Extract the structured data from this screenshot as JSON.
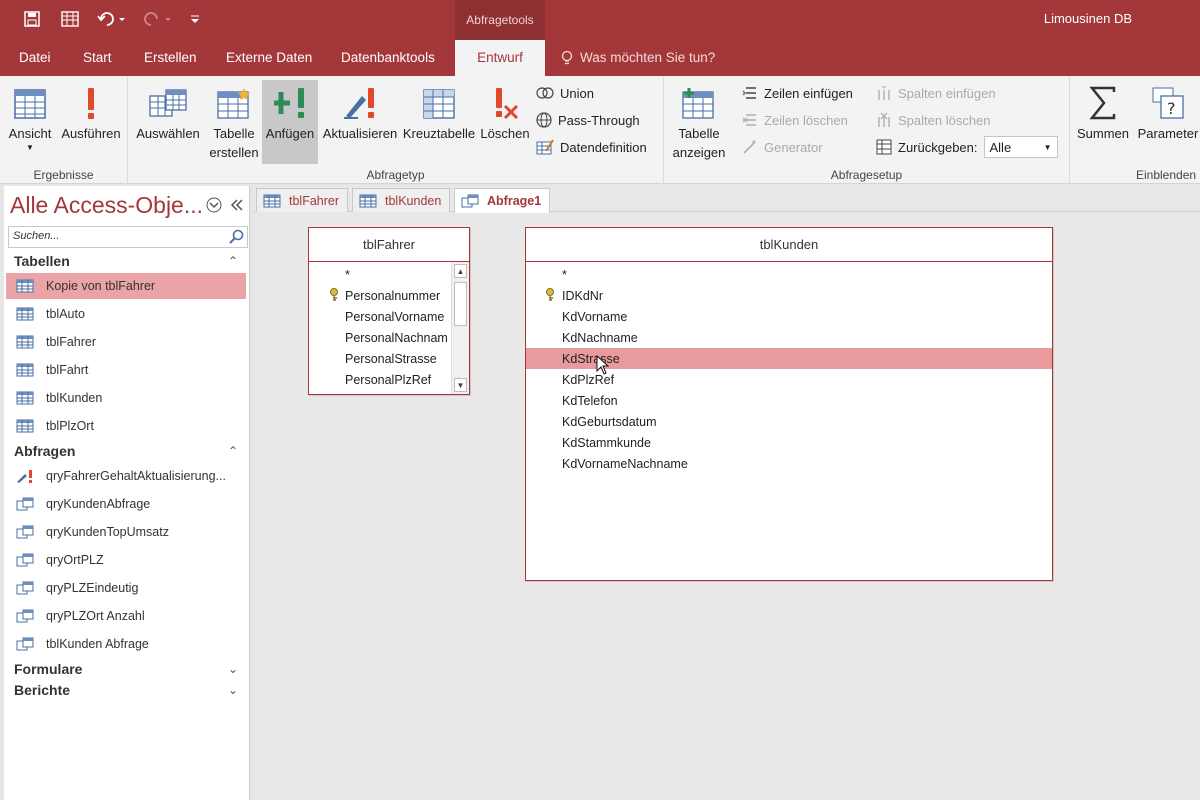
{
  "window": {
    "context_tab": "Abfragetools",
    "title": "Limousinen DB"
  },
  "ribbon_tabs": [
    "Datei",
    "Start",
    "Erstellen",
    "Externe Daten",
    "Datenbanktools",
    "Entwurf"
  ],
  "tell_me": "Was möchten Sie tun?",
  "ribbon": {
    "ergebnisse": {
      "label": "Ergebnisse",
      "ansicht": "Ansicht",
      "ausfuehren": "Ausführen"
    },
    "abfragetyp": {
      "label": "Abfragetyp",
      "auswaehlen": "Auswählen",
      "tabelle_erstellen_1": "Tabelle",
      "tabelle_erstellen_2": "erstellen",
      "anfuegen": "Anfügen",
      "aktualisieren": "Aktualisieren",
      "kreuztabelle": "Kreuztabelle",
      "loeschen": "Löschen",
      "union": "Union",
      "pass_through": "Pass-Through",
      "datendefinition": "Datendefinition"
    },
    "abfragesetup": {
      "label": "Abfragesetup",
      "tabelle_anzeigen_1": "Tabelle",
      "tabelle_anzeigen_2": "anzeigen",
      "zeilen_einfuegen": "Zeilen einfügen",
      "zeilen_loeschen": "Zeilen löschen",
      "generator": "Generator",
      "spalten_einfuegen": "Spalten einfügen",
      "spalten_loeschen": "Spalten löschen",
      "zurueckgeben": "Zurückgeben:",
      "zurueckgeben_value": "Alle"
    },
    "einblenden": {
      "label": "Einblenden",
      "summen": "Summen",
      "parameter": "Parameter"
    }
  },
  "nav": {
    "title": "Alle Access-Obje...",
    "search_placeholder": "Suchen...",
    "sections": {
      "tabellen": "Tabellen",
      "abfragen": "Abfragen",
      "formulare": "Formulare",
      "berichte": "Berichte"
    },
    "tables": [
      "Kopie von tblFahrer",
      "tblAuto",
      "tblFahrer",
      "tblFahrt",
      "tblKunden",
      "tblPlzOrt"
    ],
    "queries": [
      "qryFahrerGehaltAktualisierung...",
      "qryKundenAbfrage",
      "qryKundenTopUmsatz",
      "qryOrtPLZ",
      "qryPLZEindeutig",
      "qryPLZOrt Anzahl",
      "tblKunden Abfrage"
    ]
  },
  "doc_tabs": [
    "tblFahrer",
    "tblKunden",
    "Abfrage1"
  ],
  "field_lists": {
    "fahrer": {
      "title": "tblFahrer",
      "fields": [
        "*",
        "Personalnummer",
        "PersonalVorname",
        "PersonalNachnam",
        "PersonalStrasse",
        "PersonalPlzRef"
      ]
    },
    "kunden": {
      "title": "tblKunden",
      "fields": [
        "*",
        "IDKdNr",
        "KdVorname",
        "KdNachname",
        "KdStrasse",
        "KdPlzRef",
        "KdTelefon",
        "KdGeburtsdatum",
        "KdStammkunde",
        "KdVornameNachname"
      ]
    }
  },
  "colors": {
    "accent": "#a4373a",
    "selection": "#eaa4a7"
  }
}
